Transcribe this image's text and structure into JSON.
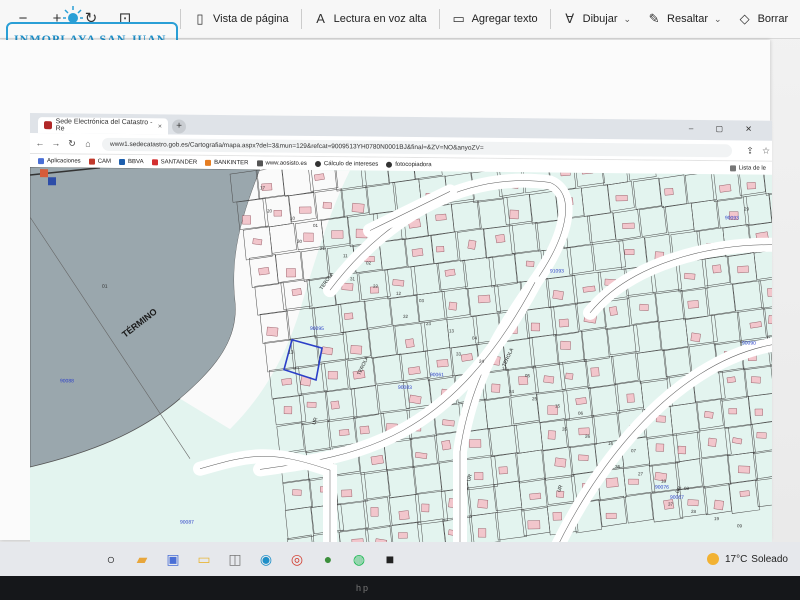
{
  "pdf_toolbar": {
    "left_icons": [
      "minus-icon",
      "plus-icon",
      "rotate-icon",
      "fit-page-icon"
    ],
    "vista": "Vista de página",
    "lectura": "Lectura en voz alta",
    "agregar": "Agregar texto",
    "dibujar": "Dibujar",
    "resaltar": "Resaltar",
    "borrar": "Borrar"
  },
  "logo": {
    "text": "INMOPLAYA SAN JUAN"
  },
  "browser": {
    "tab_title": "Sede Electrónica del Catastro - Re",
    "url": "www1.sedecatastro.gob.es/Cartografia/mapa.aspx?del=3&mun=129&refcat=9009513YH0780N0001BJ&final=&ZV=NO&anyoZV=",
    "bookmarks": [
      "Aplicaciones",
      "CAM",
      "BBVA",
      "SANTANDER",
      "BANKINTER",
      "www.aosisto.es",
      "Cálculo de intereses",
      "fotocopiadora"
    ],
    "reading_list": "Lista de le"
  },
  "map": {
    "termino_label": "TÉRMINO",
    "street_labels": [
      "TEROLA",
      "TEROLA",
      "TEROLA",
      "UR",
      "UR",
      "UR",
      "UR"
    ],
    "block_codes": [
      "90093",
      "91093",
      "90095",
      "90083",
      "90090",
      "90067",
      "90076",
      "90088",
      "90087",
      "90061"
    ],
    "parcel_numbers": [
      "17",
      "01",
      "02",
      "03",
      "04",
      "05",
      "06",
      "07",
      "08",
      "09",
      "10",
      "11",
      "12",
      "13",
      "14",
      "15",
      "16",
      "18",
      "19",
      "20",
      "21",
      "22",
      "23",
      "24",
      "25",
      "26",
      "27",
      "28",
      "29",
      "30",
      "31",
      "32",
      "33",
      "34",
      "35",
      "36",
      "37"
    ],
    "lake_parcel": "01",
    "highlighted_parcel": "13"
  },
  "taskbar": {
    "icons": [
      "start-icon",
      "explorer-icon",
      "store-icon",
      "folder-icon",
      "window-icon",
      "edge-icon",
      "chrome-icon",
      "badge-app-icon",
      "spotify-icon",
      "epic-icon"
    ],
    "temperature": "17°C",
    "weather": "Soleado"
  },
  "colors": {
    "map_bg": "#e3f4ef",
    "parcel_line": "#4a4a4a",
    "lake": "#9aa7ad",
    "building": "#f2c6cc",
    "highlight": "#2b3fc8"
  }
}
